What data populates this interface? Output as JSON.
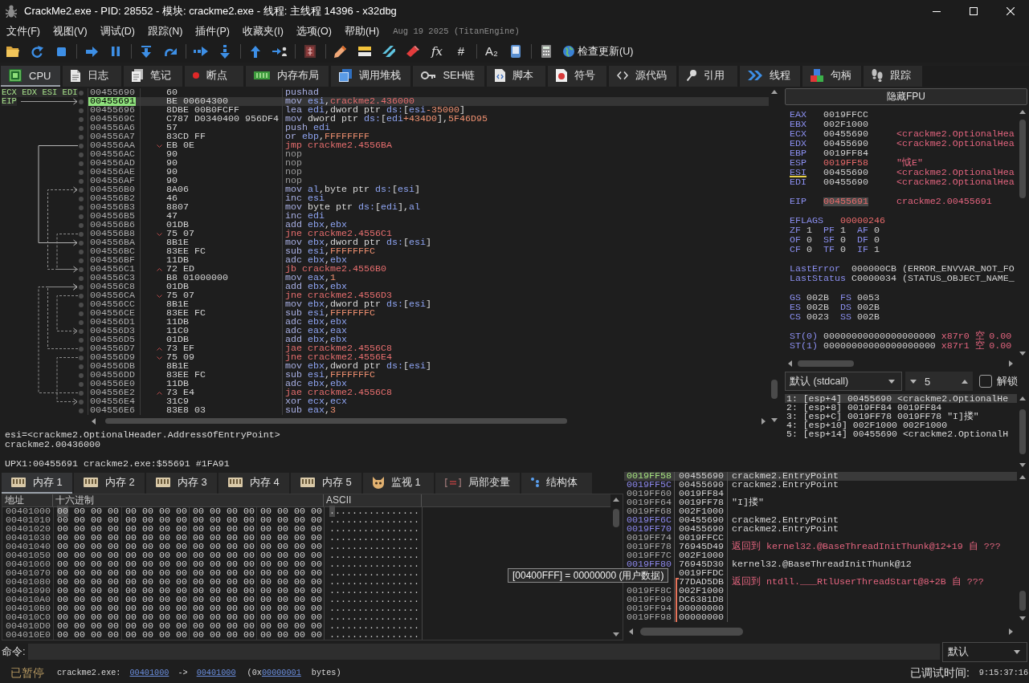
{
  "window": {
    "title": "CrackMe2.exe - PID: 28552 - 模块: crackme2.exe - 线程: 主线程 14396 - x32dbg"
  },
  "menu": {
    "items": [
      "文件(F)",
      "视图(V)",
      "调试(D)",
      "跟踪(N)",
      "插件(P)",
      "收藏夹(I)",
      "选项(O)",
      "帮助(H)"
    ],
    "build": "Aug 19 2025 (TitanEngine)"
  },
  "toolbar": [
    {
      "kind": "icon"
    },
    {
      "kind": "icon"
    },
    {
      "kind": "icon"
    },
    {
      "kind": "separator"
    },
    {
      "kind": "icon"
    },
    {
      "kind": "icon"
    },
    {
      "kind": "separator"
    },
    {
      "kind": "icon"
    },
    {
      "kind": "icon"
    },
    {
      "kind": "separator"
    },
    {
      "kind": "icon"
    },
    {
      "kind": "icon"
    },
    {
      "kind": "separator"
    },
    {
      "kind": "icon"
    },
    {
      "kind": "icon"
    },
    {
      "kind": "separator"
    },
    {
      "kind": "icon"
    },
    {
      "kind": "separator"
    },
    {
      "kind": "icon"
    },
    {
      "kind": "icon"
    },
    {
      "kind": "icon"
    },
    {
      "kind": "icon"
    },
    {
      "kind": "glyph",
      "text": "fx",
      "italic": true
    },
    {
      "kind": "glyph",
      "text": "#",
      "italic": false
    },
    {
      "kind": "separator"
    },
    {
      "kind": "glyph",
      "text": "A₂",
      "italic": false
    },
    {
      "kind": "icon"
    },
    {
      "kind": "separator"
    },
    {
      "kind": "icon"
    },
    {
      "kind": "button",
      "text": "检查更新(U)"
    }
  ],
  "tabs": [
    {
      "label": "CPU",
      "selected": true
    },
    {
      "label": "日志",
      "selected": false
    },
    {
      "label": "笔记",
      "selected": false
    },
    {
      "label": "断点",
      "selected": false
    },
    {
      "label": "内存布局",
      "selected": false
    },
    {
      "label": "调用堆栈",
      "selected": false
    },
    {
      "label": "SEH链",
      "selected": false
    },
    {
      "label": "脚本",
      "selected": false
    },
    {
      "label": "符号",
      "selected": false
    },
    {
      "label": "源代码",
      "selected": false
    },
    {
      "label": "引用",
      "selected": false
    },
    {
      "label": "线程",
      "selected": false
    },
    {
      "label": "句柄",
      "selected": false
    },
    {
      "label": "跟踪",
      "selected": false
    }
  ],
  "disassembly": {
    "rows": [
      {
        "address": "00455690",
        "bytes": "60",
        "instruction": [
          {
            "kind": "op",
            "text": "pushad"
          }
        ],
        "labels": "ECX EDX ESI EDI",
        "selected": false,
        "current": false
      },
      {
        "address": "00455691",
        "bytes": "BE 00604300",
        "instruction": [
          {
            "kind": "op",
            "text": "mov"
          },
          {
            "kind": "reg",
            "text": " esi"
          },
          {
            "kind": "plain",
            "text": ","
          },
          {
            "kind": "addr",
            "text": "crackme2.436000"
          }
        ],
        "labels": "EIP",
        "selected": true,
        "current": true
      },
      {
        "address": "00455696",
        "bytes": "8DBE 00B0FCFF",
        "instruction": [
          {
            "kind": "op",
            "text": "lea"
          },
          {
            "kind": "reg",
            "text": " edi"
          },
          {
            "kind": "plain",
            "text": ",dword ptr "
          },
          {
            "kind": "reg",
            "text": "ds:"
          },
          {
            "kind": "plain",
            "text": "["
          },
          {
            "kind": "reg",
            "text": "esi"
          },
          {
            "kind": "num",
            "text": "-35000"
          },
          {
            "kind": "plain",
            "text": "]"
          }
        ],
        "selected": false,
        "current": false
      },
      {
        "address": "0045569C",
        "bytes": "C787 D0340400 956DF4",
        "instruction": [
          {
            "kind": "op",
            "text": "mov"
          },
          {
            "kind": "plain",
            "text": " dword ptr "
          },
          {
            "kind": "reg",
            "text": "ds:"
          },
          {
            "kind": "plain",
            "text": "["
          },
          {
            "kind": "reg",
            "text": "edi"
          },
          {
            "kind": "num",
            "text": "+434D0"
          },
          {
            "kind": "plain",
            "text": "],"
          },
          {
            "kind": "num",
            "text": "5F46D95"
          }
        ],
        "selected": false,
        "current": false
      },
      {
        "address": "004556A6",
        "bytes": "57",
        "instruction": [
          {
            "kind": "op",
            "text": "push"
          },
          {
            "kind": "reg",
            "text": " edi"
          }
        ],
        "selected": false,
        "current": false
      },
      {
        "address": "004556A7",
        "bytes": "83CD FF",
        "instruction": [
          {
            "kind": "op",
            "text": "or"
          },
          {
            "kind": "reg",
            "text": " ebp"
          },
          {
            "kind": "plain",
            "text": ","
          },
          {
            "kind": "num",
            "text": "FFFFFFFF"
          }
        ],
        "selected": false,
        "current": false
      },
      {
        "address": "004556AA",
        "bytes": "EB 0E",
        "instruction": [
          {
            "kind": "jump",
            "text": "jmp "
          },
          {
            "kind": "target",
            "text": "crackme2.4556BA"
          }
        ],
        "conditional": false,
        "selected": false,
        "current": false
      },
      {
        "address": "004556AC",
        "bytes": "90",
        "instruction": [
          {
            "kind": "nop",
            "text": "nop"
          }
        ],
        "selected": false,
        "current": false
      },
      {
        "address": "004556AD",
        "bytes": "90",
        "instruction": [
          {
            "kind": "nop",
            "text": "nop"
          }
        ],
        "selected": false,
        "current": false
      },
      {
        "address": "004556AE",
        "bytes": "90",
        "instruction": [
          {
            "kind": "nop",
            "text": "nop"
          }
        ],
        "selected": false,
        "current": false
      },
      {
        "address": "004556AF",
        "bytes": "90",
        "instruction": [
          {
            "kind": "nop",
            "text": "nop"
          }
        ],
        "selected": false,
        "current": false
      },
      {
        "address": "004556B0",
        "bytes": "8A06",
        "instruction": [
          {
            "kind": "op",
            "text": "mov"
          },
          {
            "kind": "reg",
            "text": " al"
          },
          {
            "kind": "plain",
            "text": ",byte ptr "
          },
          {
            "kind": "reg",
            "text": "ds:"
          },
          {
            "kind": "plain",
            "text": "["
          },
          {
            "kind": "reg",
            "text": "esi"
          },
          {
            "kind": "plain",
            "text": "]"
          }
        ],
        "selected": false,
        "current": false
      },
      {
        "address": "004556B2",
        "bytes": "46",
        "instruction": [
          {
            "kind": "op",
            "text": "inc"
          },
          {
            "kind": "reg",
            "text": " esi"
          }
        ],
        "selected": false,
        "current": false
      },
      {
        "address": "004556B3",
        "bytes": "8807",
        "instruction": [
          {
            "kind": "op",
            "text": "mov"
          },
          {
            "kind": "plain",
            "text": " byte ptr "
          },
          {
            "kind": "reg",
            "text": "ds:"
          },
          {
            "kind": "plain",
            "text": "["
          },
          {
            "kind": "reg",
            "text": "edi"
          },
          {
            "kind": "plain",
            "text": "],"
          },
          {
            "kind": "reg",
            "text": "al"
          }
        ],
        "selected": false,
        "current": false
      },
      {
        "address": "004556B5",
        "bytes": "47",
        "instruction": [
          {
            "kind": "op",
            "text": "inc"
          },
          {
            "kind": "reg",
            "text": " edi"
          }
        ],
        "selected": false,
        "current": false
      },
      {
        "address": "004556B6",
        "bytes": "01DB",
        "instruction": [
          {
            "kind": "op",
            "text": "add"
          },
          {
            "kind": "reg",
            "text": " ebx"
          },
          {
            "kind": "plain",
            "text": ","
          },
          {
            "kind": "reg",
            "text": "ebx"
          }
        ],
        "selected": false,
        "current": false
      },
      {
        "address": "004556B8",
        "bytes": "75 07",
        "instruction": [
          {
            "kind": "jump",
            "text": "jne "
          },
          {
            "kind": "target",
            "text": "crackme2.4556C1"
          }
        ],
        "conditional": true,
        "selected": false,
        "current": false
      },
      {
        "address": "004556BA",
        "bytes": "8B1E",
        "instruction": [
          {
            "kind": "op",
            "text": "mov"
          },
          {
            "kind": "reg",
            "text": " ebx"
          },
          {
            "kind": "plain",
            "text": ",dword ptr "
          },
          {
            "kind": "reg",
            "text": "ds:"
          },
          {
            "kind": "plain",
            "text": "["
          },
          {
            "kind": "reg",
            "text": "esi"
          },
          {
            "kind": "plain",
            "text": "]"
          }
        ],
        "selected": false,
        "current": false
      },
      {
        "address": "004556BC",
        "bytes": "83EE FC",
        "instruction": [
          {
            "kind": "op",
            "text": "sub"
          },
          {
            "kind": "reg",
            "text": " esi"
          },
          {
            "kind": "plain",
            "text": ","
          },
          {
            "kind": "num",
            "text": "FFFFFFFC"
          }
        ],
        "selected": false,
        "current": false
      },
      {
        "address": "004556BF",
        "bytes": "11DB",
        "instruction": [
          {
            "kind": "op",
            "text": "adc"
          },
          {
            "kind": "reg",
            "text": " ebx"
          },
          {
            "kind": "plain",
            "text": ","
          },
          {
            "kind": "reg",
            "text": "ebx"
          }
        ],
        "selected": false,
        "current": false
      },
      {
        "address": "004556C1",
        "bytes": "72 ED",
        "instruction": [
          {
            "kind": "jump",
            "text": "jb "
          },
          {
            "kind": "target",
            "text": "crackme2.4556B0"
          }
        ],
        "conditional": true,
        "selected": false,
        "current": false
      },
      {
        "address": "004556C3",
        "bytes": "B8 01000000",
        "instruction": [
          {
            "kind": "op",
            "text": "mov"
          },
          {
            "kind": "reg",
            "text": " eax"
          },
          {
            "kind": "plain",
            "text": ","
          },
          {
            "kind": "num",
            "text": "1"
          }
        ],
        "selected": false,
        "current": false
      },
      {
        "address": "004556C8",
        "bytes": "01DB",
        "instruction": [
          {
            "kind": "op",
            "text": "add"
          },
          {
            "kind": "reg",
            "text": " ebx"
          },
          {
            "kind": "plain",
            "text": ","
          },
          {
            "kind": "reg",
            "text": "ebx"
          }
        ],
        "selected": false,
        "current": false
      },
      {
        "address": "004556CA",
        "bytes": "75 07",
        "instruction": [
          {
            "kind": "jump",
            "text": "jne "
          },
          {
            "kind": "target",
            "text": "crackme2.4556D3"
          }
        ],
        "conditional": true,
        "selected": false,
        "current": false
      },
      {
        "address": "004556CC",
        "bytes": "8B1E",
        "instruction": [
          {
            "kind": "op",
            "text": "mov"
          },
          {
            "kind": "reg",
            "text": " ebx"
          },
          {
            "kind": "plain",
            "text": ",dword ptr "
          },
          {
            "kind": "reg",
            "text": "ds:"
          },
          {
            "kind": "plain",
            "text": "["
          },
          {
            "kind": "reg",
            "text": "esi"
          },
          {
            "kind": "plain",
            "text": "]"
          }
        ],
        "selected": false,
        "current": false
      },
      {
        "address": "004556CE",
        "bytes": "83EE FC",
        "instruction": [
          {
            "kind": "op",
            "text": "sub"
          },
          {
            "kind": "reg",
            "text": " esi"
          },
          {
            "kind": "plain",
            "text": ","
          },
          {
            "kind": "num",
            "text": "FFFFFFFC"
          }
        ],
        "selected": false,
        "current": false
      },
      {
        "address": "004556D1",
        "bytes": "11DB",
        "instruction": [
          {
            "kind": "op",
            "text": "adc"
          },
          {
            "kind": "reg",
            "text": " ebx"
          },
          {
            "kind": "plain",
            "text": ","
          },
          {
            "kind": "reg",
            "text": "ebx"
          }
        ],
        "selected": false,
        "current": false
      },
      {
        "address": "004556D3",
        "bytes": "11C0",
        "instruction": [
          {
            "kind": "op",
            "text": "adc"
          },
          {
            "kind": "reg",
            "text": " eax"
          },
          {
            "kind": "plain",
            "text": ","
          },
          {
            "kind": "reg",
            "text": "eax"
          }
        ],
        "selected": false,
        "current": false
      },
      {
        "address": "004556D5",
        "bytes": "01DB",
        "instruction": [
          {
            "kind": "op",
            "text": "add"
          },
          {
            "kind": "reg",
            "text": " ebx"
          },
          {
            "kind": "plain",
            "text": ","
          },
          {
            "kind": "reg",
            "text": "ebx"
          }
        ],
        "selected": false,
        "current": false
      },
      {
        "address": "004556D7",
        "bytes": "73 EF",
        "instruction": [
          {
            "kind": "jump",
            "text": "jae "
          },
          {
            "kind": "target",
            "text": "crackme2.4556C8"
          }
        ],
        "conditional": true,
        "selected": false,
        "current": false
      },
      {
        "address": "004556D9",
        "bytes": "75 09",
        "instruction": [
          {
            "kind": "jump",
            "text": "jne "
          },
          {
            "kind": "target",
            "text": "crackme2.4556E4"
          }
        ],
        "conditional": true,
        "selected": false,
        "current": false
      },
      {
        "address": "004556DB",
        "bytes": "8B1E",
        "instruction": [
          {
            "kind": "op",
            "text": "mov"
          },
          {
            "kind": "reg",
            "text": " ebx"
          },
          {
            "kind": "plain",
            "text": ",dword ptr "
          },
          {
            "kind": "reg",
            "text": "ds:"
          },
          {
            "kind": "plain",
            "text": "["
          },
          {
            "kind": "reg",
            "text": "esi"
          },
          {
            "kind": "plain",
            "text": "]"
          }
        ],
        "selected": false,
        "current": false
      },
      {
        "address": "004556DD",
        "bytes": "83EE FC",
        "instruction": [
          {
            "kind": "op",
            "text": "sub"
          },
          {
            "kind": "reg",
            "text": " esi"
          },
          {
            "kind": "plain",
            "text": ","
          },
          {
            "kind": "num",
            "text": "FFFFFFFC"
          }
        ],
        "selected": false,
        "current": false
      },
      {
        "address": "004556E0",
        "bytes": "11DB",
        "instruction": [
          {
            "kind": "op",
            "text": "adc"
          },
          {
            "kind": "reg",
            "text": " ebx"
          },
          {
            "kind": "plain",
            "text": ","
          },
          {
            "kind": "reg",
            "text": "ebx"
          }
        ],
        "selected": false,
        "current": false
      },
      {
        "address": "004556E2",
        "bytes": "73 E4",
        "instruction": [
          {
            "kind": "jump",
            "text": "jae "
          },
          {
            "kind": "target",
            "text": "crackme2.4556C8"
          }
        ],
        "conditional": true,
        "selected": false,
        "current": false
      },
      {
        "address": "004556E4",
        "bytes": "31C9",
        "instruction": [
          {
            "kind": "op",
            "text": "xor"
          },
          {
            "kind": "reg",
            "text": " ecx"
          },
          {
            "kind": "plain",
            "text": ","
          },
          {
            "kind": "reg",
            "text": "ecx"
          }
        ],
        "selected": false,
        "current": false
      },
      {
        "address": "004556E6",
        "bytes": "83E8 03",
        "instruction": [
          {
            "kind": "op",
            "text": "sub"
          },
          {
            "kind": "reg",
            "text": " eax"
          },
          {
            "kind": "plain",
            "text": ","
          },
          {
            "kind": "num",
            "text": "3"
          }
        ],
        "selected": false,
        "current": false
      }
    ]
  },
  "info": {
    "lines": [
      "esi=<crackme2.OptionalHeader.AddressOfEntryPoint>",
      "crackme2.00436000"
    ],
    "location": "UPX1:00455691 crackme2.exe:$55691 #1FA91"
  },
  "registers": {
    "toggle": "隐藏FPU",
    "rows": [
      {
        "kind": "register",
        "name": "EAX",
        "value": "0019FFCC",
        "changed": false,
        "underlined": false,
        "selected": false
      },
      {
        "kind": "register",
        "name": "EBX",
        "value": "002F1000",
        "changed": false,
        "underlined": false,
        "selected": false
      },
      {
        "kind": "register",
        "name": "ECX",
        "value": "00455690",
        "comment": "<crackme2.OptionalHea",
        "changed": false,
        "underlined": false,
        "selected": false
      },
      {
        "kind": "register",
        "name": "EDX",
        "value": "00455690",
        "comment": "<crackme2.OptionalHea",
        "changed": false,
        "underlined": false,
        "selected": false
      },
      {
        "kind": "register",
        "name": "EBP",
        "value": "0019FF84",
        "changed": false,
        "underlined": false,
        "selected": false
      },
      {
        "kind": "register",
        "name": "ESP",
        "value": "0019FF58",
        "comment": "\"怴E\"",
        "changed": true,
        "underlined": false,
        "selected": false
      },
      {
        "kind": "register",
        "name": "ESI",
        "value": "00455690",
        "comment": "<crackme2.OptionalHea",
        "changed": false,
        "underlined": true,
        "selected": false
      },
      {
        "kind": "register",
        "name": "EDI",
        "value": "00455690",
        "comment": "<crackme2.OptionalHea",
        "changed": false,
        "underlined": false,
        "selected": false
      },
      {
        "kind": "blank"
      },
      {
        "kind": "register",
        "name": "EIP",
        "value": "00455691",
        "comment": "crackme2.00455691",
        "changed": true,
        "underlined": false,
        "selected": true
      },
      {
        "kind": "blank"
      },
      {
        "kind": "eflags",
        "name": "EFLAGS",
        "value": "00000246",
        "changed": true
      },
      {
        "kind": "flags",
        "items": [
          {
            "name": "ZF",
            "value": "1"
          },
          {
            "name": "PF",
            "value": "1"
          },
          {
            "name": "AF",
            "value": "0"
          }
        ]
      },
      {
        "kind": "flags",
        "items": [
          {
            "name": "OF",
            "value": "0"
          },
          {
            "name": "SF",
            "value": "0"
          },
          {
            "name": "DF",
            "value": "0"
          }
        ]
      },
      {
        "kind": "flags",
        "items": [
          {
            "name": "CF",
            "value": "0"
          },
          {
            "name": "TF",
            "value": "0"
          },
          {
            "name": "IF",
            "value": "1"
          }
        ]
      },
      {
        "kind": "blank"
      },
      {
        "kind": "status",
        "name": "LastError",
        "value": "000000CB",
        "text": "(ERROR_ENVVAR_NOT_FO"
      },
      {
        "kind": "status",
        "name": "LastStatus",
        "value": "C0000034",
        "text": "(STATUS_OBJECT_NAME_"
      },
      {
        "kind": "blank"
      },
      {
        "kind": "segments",
        "items": [
          {
            "name": "GS",
            "value": "002B"
          },
          {
            "name": "FS",
            "value": "0053"
          }
        ]
      },
      {
        "kind": "segments",
        "items": [
          {
            "name": "ES",
            "value": "002B"
          },
          {
            "name": "DS",
            "value": "002B"
          }
        ]
      },
      {
        "kind": "segments",
        "items": [
          {
            "name": "CS",
            "value": "0023"
          },
          {
            "name": "SS",
            "value": "002B"
          }
        ]
      },
      {
        "kind": "blank"
      },
      {
        "kind": "fpu",
        "name": "ST(0)",
        "value": "00000000000000000000",
        "register": "x87r0",
        "tag": "空",
        "number": "0.00"
      },
      {
        "kind": "fpu",
        "name": "ST(1)",
        "value": "00000000000000000000",
        "register": "x87r1",
        "tag": "空",
        "number": "0.00"
      }
    ]
  },
  "call_args": {
    "convention": "默认 (stdcall)",
    "count": "5",
    "unlock": {
      "label": "解锁",
      "checked": false
    },
    "rows": [
      {
        "text": "1: [esp+4] 00455690 <crackme2.OptionalHe",
        "selected": true
      },
      {
        "text": "2: [esp+8] 0019FF84 0019FF84",
        "selected": false
      },
      {
        "text": "3: [esp+C] 0019FF78 0019FF78 \"I]搂\"",
        "selected": false
      },
      {
        "text": "4: [esp+10] 002F1000 002F1000",
        "selected": false
      },
      {
        "text": "5: [esp+14] 00455690 <crackme2.OptionalH",
        "selected": false
      }
    ]
  },
  "dump_tabs": [
    {
      "label": "内存 1",
      "selected": true
    },
    {
      "label": "内存 2",
      "selected": false
    },
    {
      "label": "内存 3",
      "selected": false
    },
    {
      "label": "内存 4",
      "selected": false
    },
    {
      "label": "内存 5",
      "selected": false
    },
    {
      "label": "监视 1",
      "selected": false
    },
    {
      "label": "局部变量",
      "selected": false
    },
    {
      "label": "结构体",
      "selected": false
    }
  ],
  "dump": {
    "columns": [
      "地址",
      "十六进制",
      "ASCII"
    ],
    "rows": [
      {
        "address": "00401000",
        "hex": [
          "00 00 00 00",
          "00 00 00 00",
          "00 00 00 00",
          "00 00 00 00"
        ],
        "ascii": "................",
        "selected": true
      },
      {
        "address": "00401010",
        "hex": [
          "00 00 00 00",
          "00 00 00 00",
          "00 00 00 00",
          "00 00 00 00"
        ],
        "ascii": "................",
        "selected": false
      },
      {
        "address": "00401020",
        "hex": [
          "00 00 00 00",
          "00 00 00 00",
          "00 00 00 00",
          "00 00 00 00"
        ],
        "ascii": "................",
        "selected": false
      },
      {
        "address": "00401030",
        "hex": [
          "00 00 00 00",
          "00 00 00 00",
          "00 00 00 00",
          "00 00 00 00"
        ],
        "ascii": "................",
        "selected": false
      },
      {
        "address": "00401040",
        "hex": [
          "00 00 00 00",
          "00 00 00 00",
          "00 00 00 00",
          "00 00 00 00"
        ],
        "ascii": "................",
        "selected": false
      },
      {
        "address": "00401050",
        "hex": [
          "00 00 00 00",
          "00 00 00 00",
          "00 00 00 00",
          "00 00 00 00"
        ],
        "ascii": "................",
        "selected": false
      },
      {
        "address": "00401060",
        "hex": [
          "00 00 00 00",
          "00 00 00 00",
          "00 00 00 00",
          "00 00 00 00"
        ],
        "ascii": "................",
        "selected": false
      },
      {
        "address": "00401070",
        "hex": [
          "00 00 00 00",
          "00 00 00 00",
          "00 00 00 00",
          "00 00 00 00"
        ],
        "ascii": "................",
        "selected": false
      },
      {
        "address": "00401080",
        "hex": [
          "00 00 00 00",
          "00 00 00 00",
          "00 00 00 00",
          "00 00 00 00"
        ],
        "ascii": "................",
        "selected": false
      },
      {
        "address": "00401090",
        "hex": [
          "00 00 00 00",
          "00 00 00 00",
          "00 00 00 00",
          "00 00 00 00"
        ],
        "ascii": "................",
        "selected": false
      },
      {
        "address": "004010A0",
        "hex": [
          "00 00 00 00",
          "00 00 00 00",
          "00 00 00 00",
          "00 00 00 00"
        ],
        "ascii": "................",
        "selected": false
      },
      {
        "address": "004010B0",
        "hex": [
          "00 00 00 00",
          "00 00 00 00",
          "00 00 00 00",
          "00 00 00 00"
        ],
        "ascii": "................",
        "selected": false
      },
      {
        "address": "004010C0",
        "hex": [
          "00 00 00 00",
          "00 00 00 00",
          "00 00 00 00",
          "00 00 00 00"
        ],
        "ascii": "................",
        "selected": false
      },
      {
        "address": "004010D0",
        "hex": [
          "00 00 00 00",
          "00 00 00 00",
          "00 00 00 00",
          "00 00 00 00"
        ],
        "ascii": "................",
        "selected": false
      },
      {
        "address": "004010E0",
        "hex": [
          "00 00 00 00",
          "00 00 00 00",
          "00 00 00 00",
          "00 00 00 00"
        ],
        "ascii": "................",
        "selected": false
      }
    ]
  },
  "tooltip": "[00400FFF] = 00000000 (用户数据)",
  "stack": {
    "rows": [
      {
        "address": "0019FF58",
        "color": "#a4e07e",
        "value": "00455690",
        "comment": {
          "kind": "symbol",
          "text": "crackme2.EntryPoint"
        },
        "selected": true,
        "in_frame": false
      },
      {
        "address": "0019FF5C",
        "color": "#8c88ec",
        "value": "00455690",
        "comment": {
          "kind": "symbol",
          "text": "crackme2.EntryPoint"
        },
        "selected": false,
        "in_frame": false
      },
      {
        "address": "0019FF60",
        "color": "#a8a8a8",
        "value": "0019FF84",
        "selected": false,
        "in_frame": false
      },
      {
        "address": "0019FF64",
        "color": "#a8a8a8",
        "value": "0019FF78",
        "comment": {
          "kind": "string",
          "text": "\"I]搂\""
        },
        "selected": false,
        "in_frame": false
      },
      {
        "address": "0019FF68",
        "color": "#a8a8a8",
        "value": "002F1000",
        "selected": false,
        "in_frame": false
      },
      {
        "address": "0019FF6C",
        "color": "#8c88ec",
        "value": "00455690",
        "comment": {
          "kind": "symbol",
          "text": "crackme2.EntryPoint"
        },
        "selected": false,
        "in_frame": false
      },
      {
        "address": "0019FF70",
        "color": "#8c88ec",
        "value": "00455690",
        "comment": {
          "kind": "symbol",
          "text": "crackme2.EntryPoint"
        },
        "selected": false,
        "in_frame": false
      },
      {
        "address": "0019FF74",
        "color": "#a8a8a8",
        "value": "0019FFCC",
        "selected": false,
        "in_frame": false
      },
      {
        "address": "0019FF78",
        "color": "#a8a8a8",
        "value": "76945D49",
        "comment": {
          "kind": "return",
          "text": "返回到 kernel32.@BaseThreadInitThunk@12+19 自 ???"
        },
        "selected": false,
        "in_frame": false
      },
      {
        "address": "0019FF7C",
        "color": "#a8a8a8",
        "value": "002F1000",
        "selected": false,
        "in_frame": false
      },
      {
        "address": "0019FF80",
        "color": "#8c88ec",
        "value": "76945D30",
        "comment": {
          "kind": "symbol",
          "text": "kernel32.@BaseThreadInitThunk@12"
        },
        "selected": false,
        "in_frame": false
      },
      {
        "value": "0019FFDC",
        "selected": false,
        "in_frame": false
      },
      {
        "value": "77DAD5DB",
        "comment": {
          "kind": "return",
          "text": "返回到 ntdll.___RtlUserThreadStart@8+2B 自 ???"
        },
        "selected": false,
        "in_frame": true
      },
      {
        "address": "0019FF8C",
        "color": "#a8a8a8",
        "value": "002F1000",
        "selected": false,
        "in_frame": true
      },
      {
        "address": "0019FF90",
        "color": "#a8a8a8",
        "value": "DC6381D8",
        "selected": false,
        "in_frame": true
      },
      {
        "address": "0019FF94",
        "color": "#a8a8a8",
        "value": "00000000",
        "selected": false,
        "in_frame": true
      },
      {
        "address": "0019FF98",
        "color": "#a8a8a8",
        "value": "00000000",
        "selected": false,
        "in_frame": true
      }
    ]
  },
  "command": {
    "label": "命令:",
    "mode": "默认"
  },
  "status": {
    "state": "已暂停",
    "module": "crackme2.exe:",
    "start": "00401000",
    "arrow": "->",
    "end": "00401000",
    "size_prefix": "(0x",
    "size": "00000001",
    "size_suffix": "bytes)",
    "elapsed_label": "已调试时间:",
    "elapsed": "9:15:37:16"
  }
}
